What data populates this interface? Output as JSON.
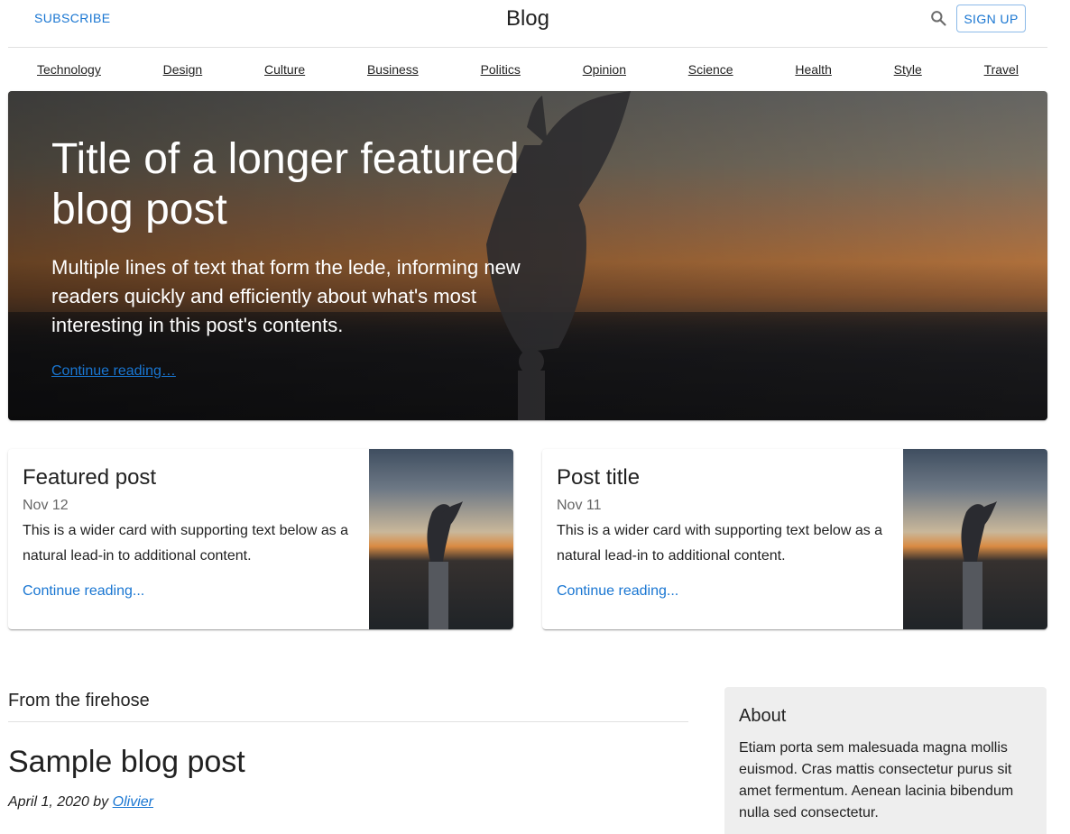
{
  "header": {
    "subscribe_label": "SUBSCRIBE",
    "title": "Blog",
    "search_icon": "search-icon",
    "signup_label": "SIGN UP"
  },
  "nav": {
    "items": [
      {
        "label": "Technology"
      },
      {
        "label": "Design"
      },
      {
        "label": "Culture"
      },
      {
        "label": "Business"
      },
      {
        "label": "Politics"
      },
      {
        "label": "Opinion"
      },
      {
        "label": "Science"
      },
      {
        "label": "Health"
      },
      {
        "label": "Style"
      },
      {
        "label": "Travel"
      }
    ]
  },
  "hero": {
    "title": "Title of a longer featured blog post",
    "lede": "Multiple lines of text that form the lede, informing new readers quickly and efficiently about what's most interesting in this post's contents.",
    "link_label": "Continue reading…"
  },
  "cards": [
    {
      "title": "Featured post",
      "date": "Nov 12",
      "text": "This is a wider card with supporting text below as a natural lead-in to additional content.",
      "link_label": "Continue reading..."
    },
    {
      "title": "Post title",
      "date": "Nov 11",
      "text": "This is a wider card with supporting text below as a natural lead-in to additional content.",
      "link_label": "Continue reading..."
    }
  ],
  "main": {
    "section_title": "From the firehose",
    "post_title": "Sample blog post",
    "post_date_prefix": "April 1, 2020 by",
    "post_author": "Olivier"
  },
  "sidebar": {
    "about_title": "About",
    "about_text": "Etiam porta sem malesuada magna mollis euismod. Cras mattis consectetur purus sit amet fermentum. Aenean lacinia bibendum nulla sed consectetur."
  },
  "colors": {
    "accent": "#1976d2",
    "sidebar_bg": "#eeeeee"
  }
}
